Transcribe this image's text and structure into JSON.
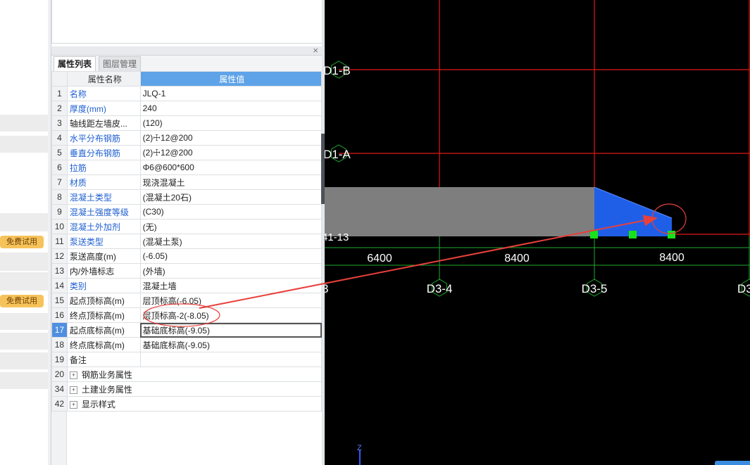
{
  "left_strip": {
    "trial_label": "免费试用"
  },
  "panel": {
    "close_glyph": "×",
    "tabs": [
      {
        "label": "属性列表",
        "active": true
      },
      {
        "label": "图层管理",
        "active": false
      }
    ],
    "columns": {
      "name": "属性名称",
      "value": "属性值"
    },
    "rows": [
      {
        "num": "1",
        "name": "名称",
        "value": "JLQ-1",
        "blue": true
      },
      {
        "num": "2",
        "name": "厚度(mm)",
        "value": "240",
        "blue": true
      },
      {
        "num": "3",
        "name": "轴线距左墙皮...",
        "value": "(120)",
        "blue": false
      },
      {
        "num": "4",
        "name": "水平分布钢筋",
        "value": "(2)☩12@200",
        "blue": true
      },
      {
        "num": "5",
        "name": "垂直分布钢筋",
        "value": "(2)☩12@200",
        "blue": true
      },
      {
        "num": "6",
        "name": "拉筋",
        "value": "Φ6@600*600",
        "blue": true
      },
      {
        "num": "7",
        "name": "材质",
        "value": "现浇混凝土",
        "blue": true
      },
      {
        "num": "8",
        "name": "混凝土类型",
        "value": "(混凝土20石)",
        "blue": true
      },
      {
        "num": "9",
        "name": "混凝土强度等级",
        "value": "(C30)",
        "blue": true
      },
      {
        "num": "10",
        "name": "混凝土外加剂",
        "value": "(无)",
        "blue": true
      },
      {
        "num": "11",
        "name": "泵送类型",
        "value": "(混凝土泵)",
        "blue": true
      },
      {
        "num": "12",
        "name": "泵送高度(m)",
        "value": "(-6.05)",
        "blue": false
      },
      {
        "num": "13",
        "name": "内/外墙标志",
        "value": "(外墙)",
        "blue": false
      },
      {
        "num": "14",
        "name": "类别",
        "value": "混凝土墙",
        "blue": true
      },
      {
        "num": "15",
        "name": "起点顶标高(m)",
        "value": "层顶标高(-6.05)",
        "blue": false
      },
      {
        "num": "16",
        "name": "终点顶标高(m)",
        "value": "层顶标高-2(-8.05)",
        "blue": false
      },
      {
        "num": "17",
        "name": "起点底标高(m)",
        "value": "基础底标高(-9.05)",
        "blue": false,
        "selected": true
      },
      {
        "num": "18",
        "name": "终点底标高(m)",
        "value": "基础底标高(-9.05)",
        "blue": false
      },
      {
        "num": "19",
        "name": "备注",
        "value": "",
        "blue": false
      },
      {
        "num": "20",
        "name": "钢筋业务属性",
        "value": "",
        "blue": false,
        "group": true
      },
      {
        "num": "34",
        "name": "土建业务属性",
        "value": "",
        "blue": false,
        "group": true
      },
      {
        "num": "42",
        "name": "显示样式",
        "value": "",
        "blue": false,
        "group": true
      }
    ],
    "expand_glyph": "+"
  },
  "viewport": {
    "axis_labels": [
      "D1-B",
      "D1-A",
      "D3-4",
      "D3-5",
      "D3",
      "3",
      "41-13"
    ],
    "dimensions": [
      "6400",
      "8400",
      "8400"
    ],
    "z_axis_label": "Z",
    "colors": {
      "background": "#000000",
      "grid": "#e01818",
      "dimension_line": "#1faa2e",
      "wall_top": "#7e7e7e",
      "wall_end": "#1f5fe8",
      "grip": "#19e219",
      "annotation": "#e8403c"
    }
  }
}
